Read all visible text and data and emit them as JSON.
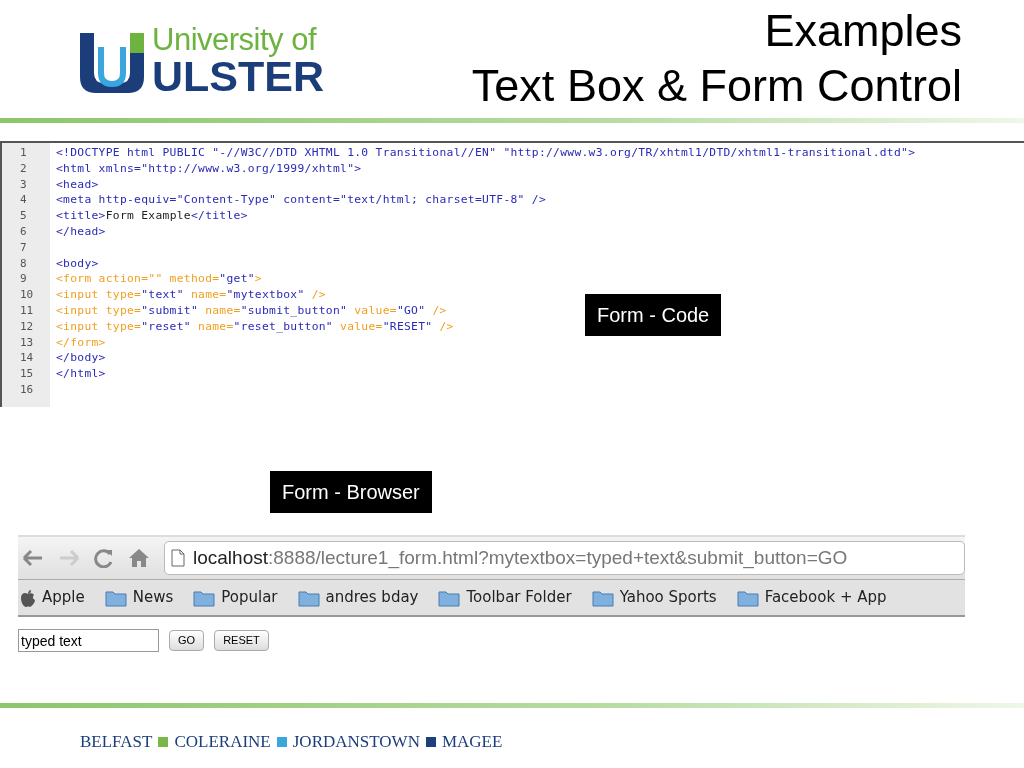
{
  "logo": {
    "line_1": "University of",
    "line_2": "ULSTER"
  },
  "title": [
    "Examples",
    "Text Box & Form Control"
  ],
  "code_editor": {
    "lines": [
      {
        "number": "1",
        "segments": [
          {
            "text": "<!DOCTYPE html PUBLIC \"-//W3C//DTD XHTML 1.0 Transitional//EN\" \"http://www.w3.org/TR/xhtml1/DTD/xhtml1-transitional.dtd\">",
            "kind": "tag"
          }
        ]
      },
      {
        "number": "2",
        "segments": [
          {
            "text": "<html xmlns=\"http://www.w3.org/1999/xhtml\">",
            "kind": "tag"
          }
        ]
      },
      {
        "number": "3",
        "segments": [
          {
            "text": "<head>",
            "kind": "tag"
          }
        ]
      },
      {
        "number": "4",
        "segments": [
          {
            "text": "<meta http-equiv=\"Content-Type\" content=\"text/html; charset=UTF-8\" />",
            "kind": "tag"
          }
        ]
      },
      {
        "number": "5",
        "segments": [
          {
            "text": "<title>",
            "kind": "tag"
          },
          {
            "text": "Form Example",
            "kind": "text"
          },
          {
            "text": "</title>",
            "kind": "tag"
          }
        ]
      },
      {
        "number": "6",
        "segments": [
          {
            "text": "</head>",
            "kind": "tag"
          }
        ]
      },
      {
        "number": "7"
      },
      {
        "number": "8",
        "segments": [
          {
            "text": "<body>",
            "kind": "tag"
          }
        ]
      },
      {
        "number": "9",
        "segments": [
          {
            "text": "<form action=\"\" method=",
            "kind": "attr"
          },
          {
            "text": "\"get\"",
            "kind": "string"
          },
          {
            "text": ">",
            "kind": "attr"
          }
        ]
      },
      {
        "number": "10",
        "segments": [
          {
            "text": "<input type=",
            "kind": "attr"
          },
          {
            "text": "\"text\"",
            "kind": "string"
          },
          {
            "text": " name=",
            "kind": "attr"
          },
          {
            "text": "\"mytextbox\"",
            "kind": "string"
          },
          {
            "text": " />",
            "kind": "attr"
          }
        ]
      },
      {
        "number": "11",
        "segments": [
          {
            "text": "<input type=",
            "kind": "attr"
          },
          {
            "text": "\"submit\"",
            "kind": "string"
          },
          {
            "text": " name=",
            "kind": "attr"
          },
          {
            "text": "\"submit_button\"",
            "kind": "string"
          },
          {
            "text": " value=",
            "kind": "attr"
          },
          {
            "text": "\"GO\"",
            "kind": "string"
          },
          {
            "text": " />",
            "kind": "attr"
          }
        ]
      },
      {
        "number": "12",
        "segments": [
          {
            "text": "<input type=",
            "kind": "attr"
          },
          {
            "text": "\"reset\"",
            "kind": "string"
          },
          {
            "text": " name=",
            "kind": "attr"
          },
          {
            "text": "\"reset_button\"",
            "kind": "string"
          },
          {
            "text": " value=",
            "kind": "attr"
          },
          {
            "text": "\"RESET\"",
            "kind": "string"
          },
          {
            "text": " />",
            "kind": "attr"
          }
        ]
      },
      {
        "number": "13",
        "segments": [
          {
            "text": "</form>",
            "kind": "attr"
          }
        ]
      },
      {
        "number": "14",
        "segments": [
          {
            "text": "</body>",
            "kind": "tag"
          }
        ]
      },
      {
        "number": "15",
        "segments": [
          {
            "text": "</html>",
            "kind": "tag"
          }
        ]
      },
      {
        "number": "16"
      }
    ]
  },
  "code_label": "Form - Code",
  "browser_label": "Form - Browser",
  "browser": {
    "url_host": "localhost",
    "url_rest": ":8888/lecture1_form.html?mytextbox=typed+text&submit_button=GO",
    "bookmarks": [
      {
        "label": "Apple",
        "kind": "apple"
      },
      {
        "label": "News",
        "kind": "folder"
      },
      {
        "label": "Popular",
        "kind": "folder"
      },
      {
        "label": "andres bday",
        "kind": "folder"
      },
      {
        "label": "Toolbar Folder",
        "kind": "folder"
      },
      {
        "label": "Yahoo Sports",
        "kind": "folder"
      },
      {
        "label": "Facebook + App",
        "kind": "folder"
      }
    ],
    "form": {
      "text_value": "typed text",
      "buttons": [
        "GO",
        "RESET"
      ]
    }
  },
  "footer": {
    "campuses": [
      "BELFAST",
      "COLERAINE",
      "JORDANSTOWN",
      "MAGEE"
    ],
    "separators": [
      {
        "color": "#7ab648"
      },
      {
        "color": "#3aa6dd"
      },
      {
        "color": "#1d3f7a"
      }
    ]
  }
}
